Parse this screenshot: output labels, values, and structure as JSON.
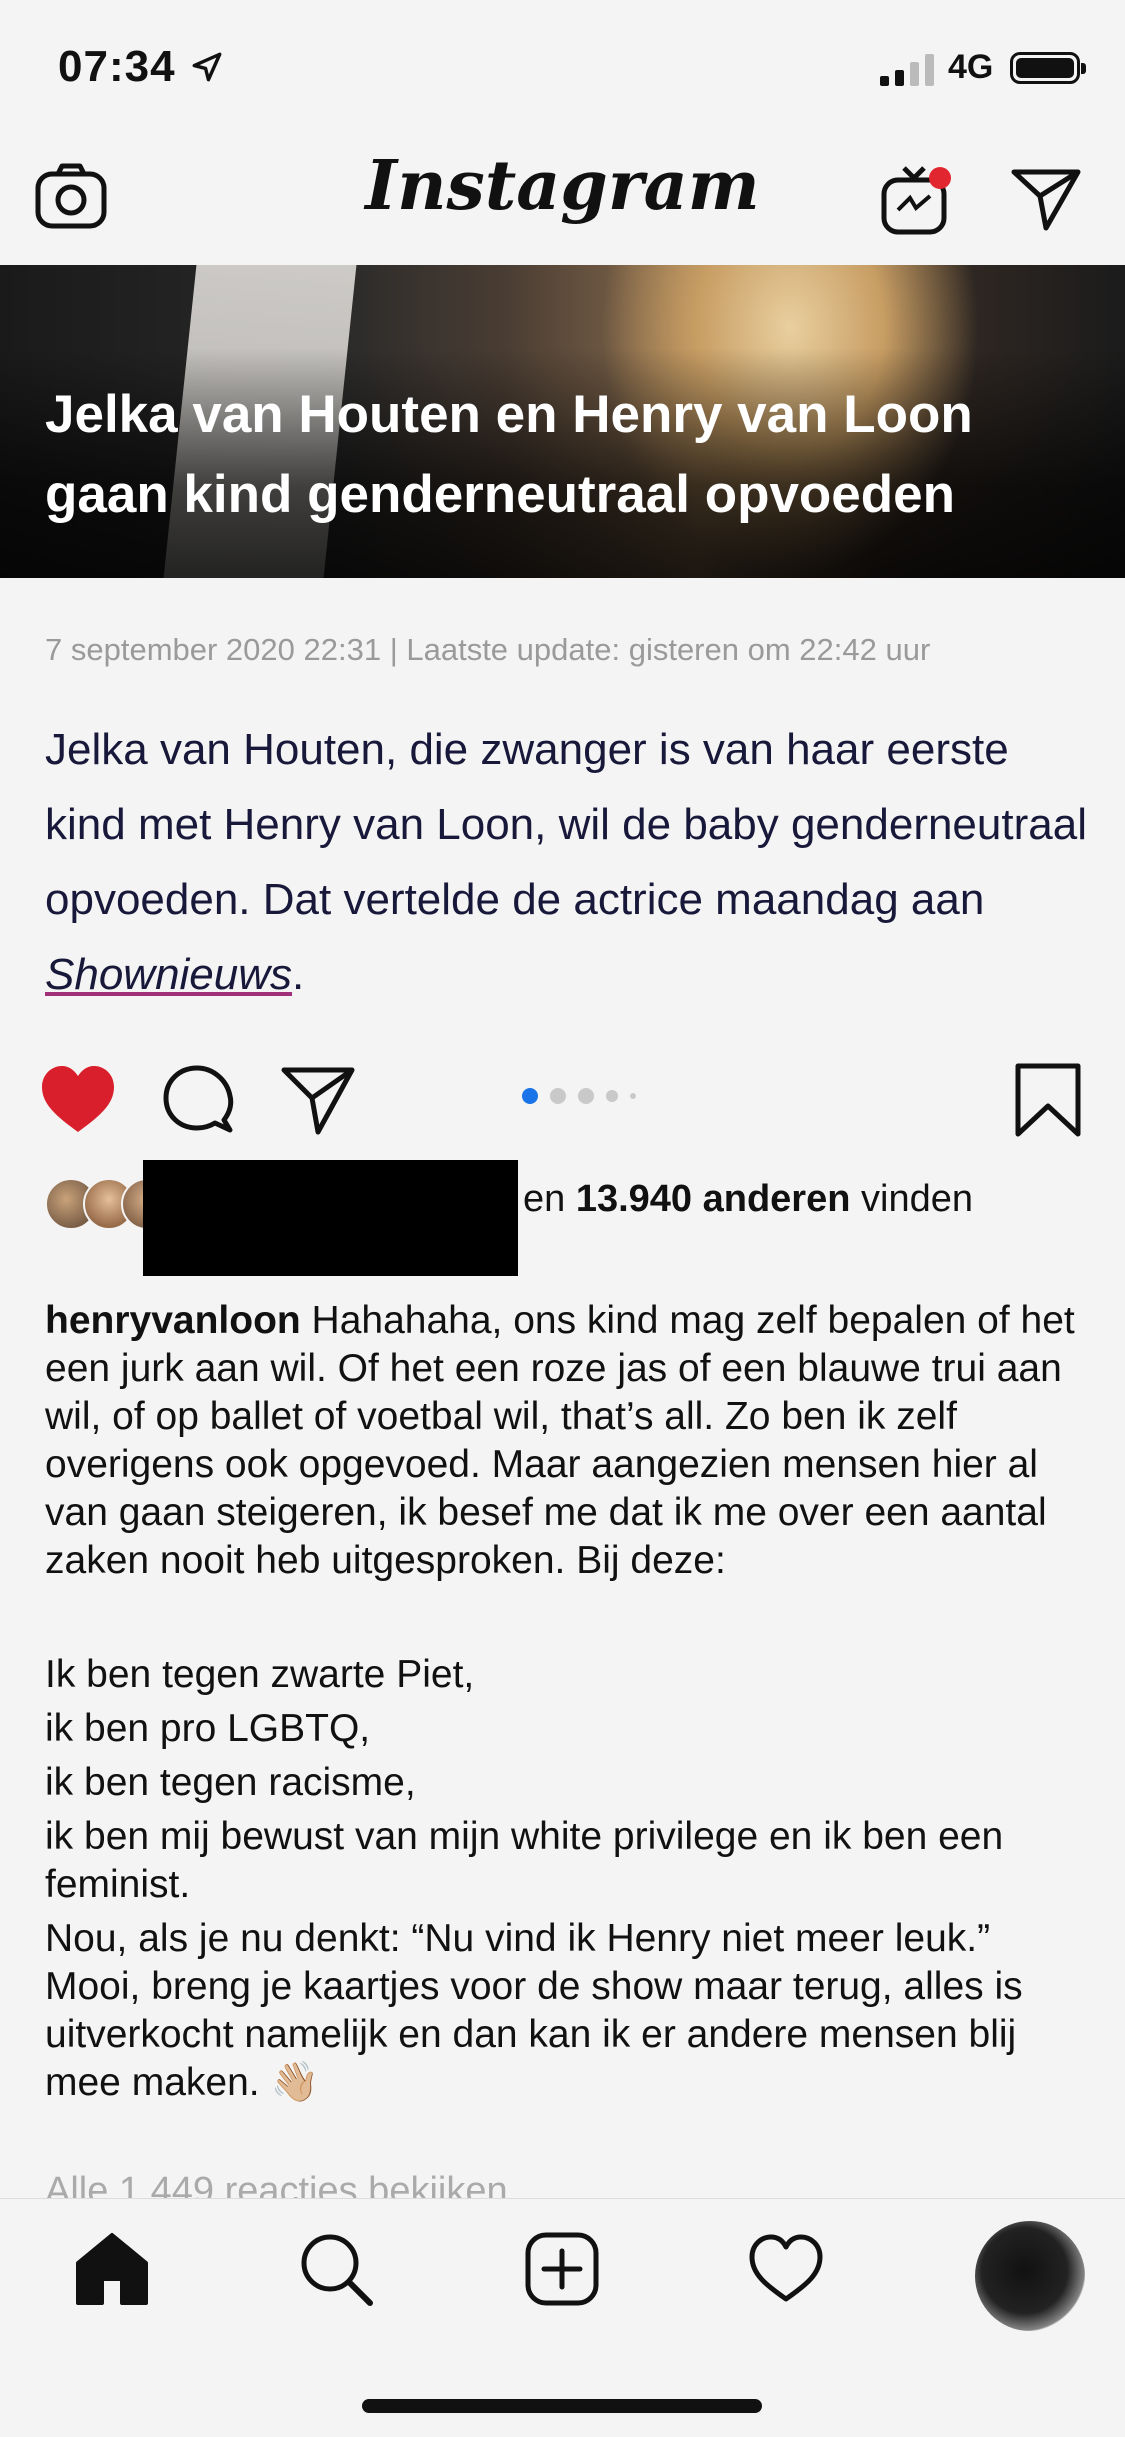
{
  "status_bar": {
    "time": "07:34",
    "network": "4G"
  },
  "header": {
    "logo": "Instagram"
  },
  "post": {
    "banner_title": "Jelka van Houten en Henry van Loon gaan kind genderneutraal opvoeden",
    "date_line": "7 september 2020 22:31 | Laatste update: gisteren om 22:42 uur",
    "lead_before_link": "Jelka van Houten, die zwanger is van haar eerste kind met Henry van Loon, wil de baby genderneutraal opvoeden. Dat vertelde de actrice maandag aan ",
    "lead_link": "Shownieuws",
    "lead_after_link": ".",
    "carousel": {
      "total": 5,
      "active": 1
    },
    "liked": true
  },
  "likes": {
    "prefix": "en ",
    "count_text": "13.940 anderen",
    "suffix": " vinden"
  },
  "caption": {
    "username": "henryvanloon",
    "para1": " Hahahaha, ons kind mag zelf bepalen of het een jurk aan wil. Of het een roze jas of een blauwe trui aan wil, of op ballet of voetbal wil, that’s all. Zo ben ik zelf overigens ook opgevoed. Maar aangezien mensen hier al van gaan steigeren, ik besef me dat ik me over een aantal zaken nooit heb uitgesproken. Bij deze:",
    "line1": "Ik ben tegen zwarte Piet,",
    "line2": "ik ben pro LGBTQ,",
    "line3": "ik ben tegen racisme,",
    "line4": "ik ben mij bewust van mijn white privilege en ik ben een feminist.",
    "para2": "Nou, als je nu denkt: “Nu vind ik Henry niet meer leuk.” Mooi, breng je kaartjes voor de show maar terug, alles is uitverkocht namelijk en dan kan ik er andere mensen blij mee maken. ",
    "emoji": "👋🏼"
  },
  "view_comments": "Alle 1.449 reacties bekijken",
  "colors": {
    "heart": "#d91f2b",
    "carousel_active": "#1a73e8",
    "lead_text": "#18183a"
  },
  "icons": [
    "camera-icon",
    "igtv-icon",
    "direct-message-icon",
    "heart-icon",
    "comment-icon",
    "share-icon",
    "bookmark-icon",
    "home-icon",
    "search-icon",
    "new-post-icon",
    "activity-icon"
  ]
}
